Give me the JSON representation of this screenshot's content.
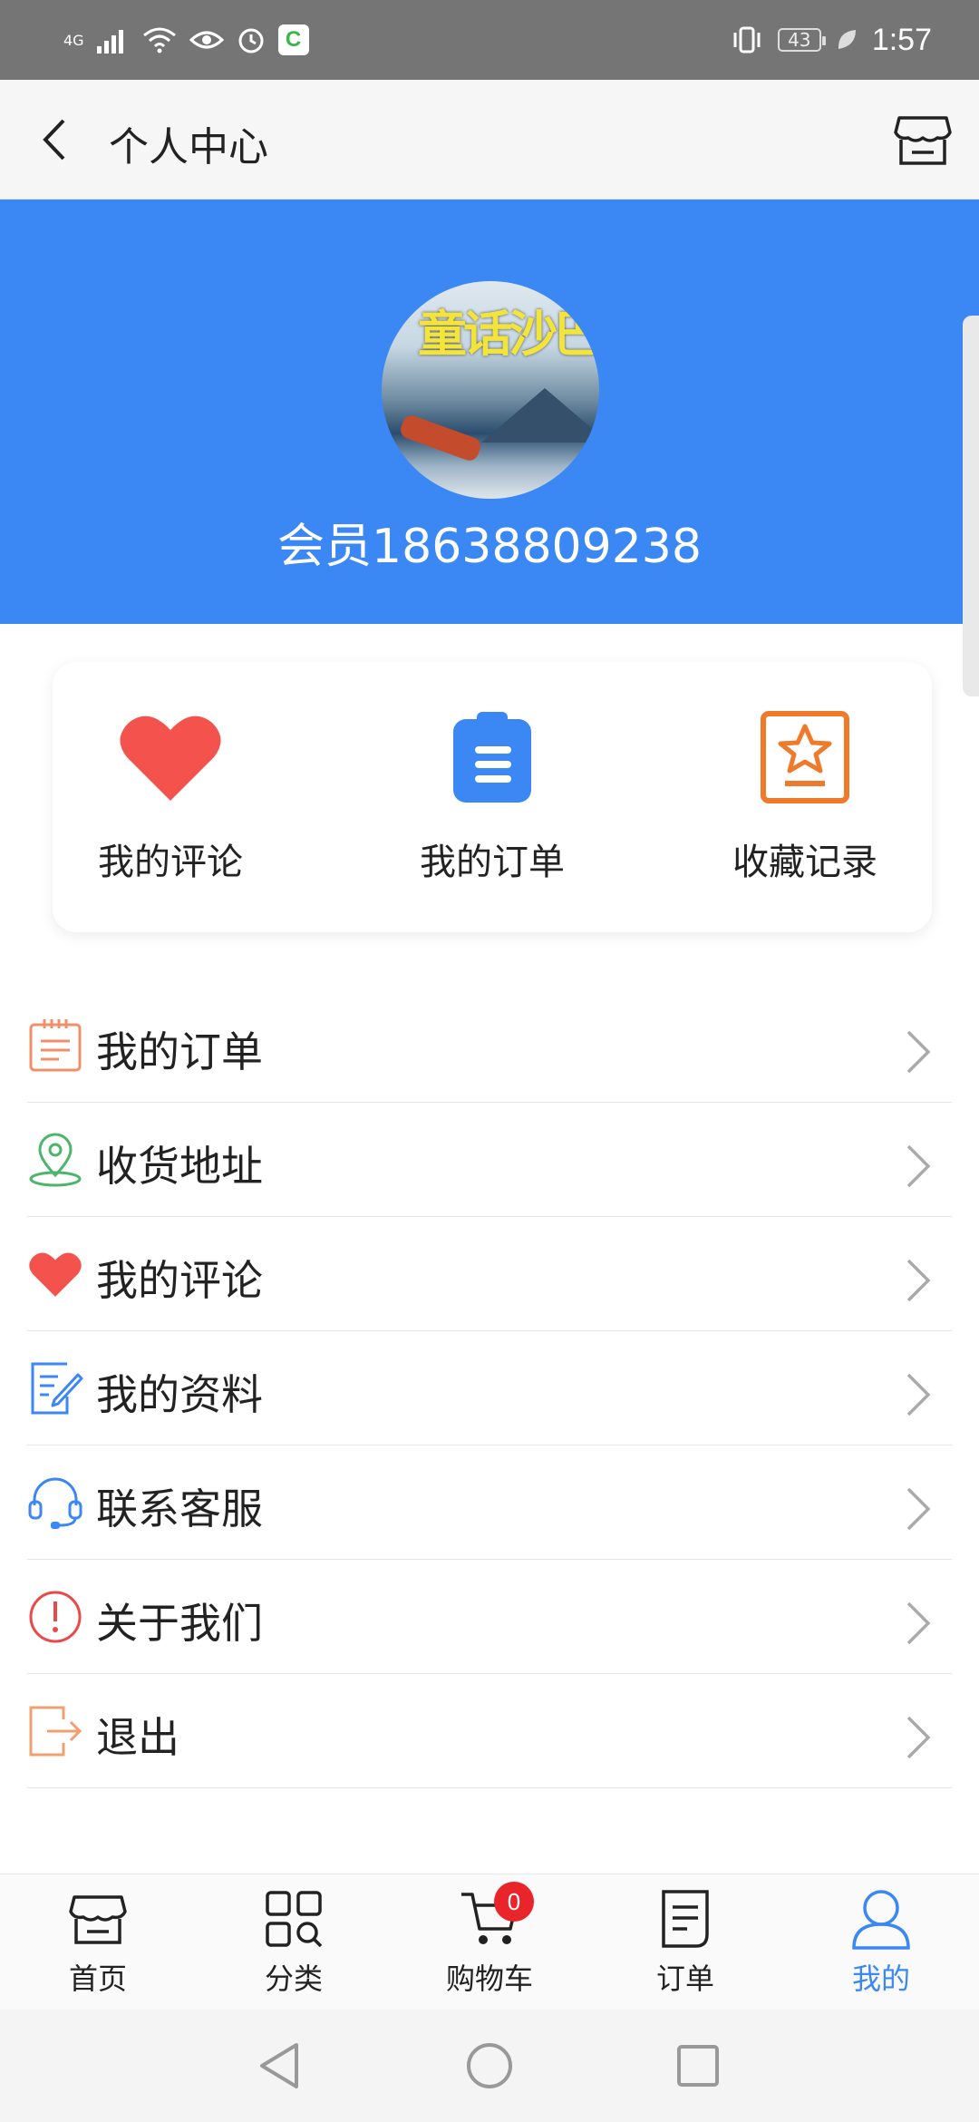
{
  "status_bar": {
    "network": "4G",
    "battery": "43",
    "time": "1:57"
  },
  "header": {
    "title": "个人中心"
  },
  "profile": {
    "member_name": "会员18638809238",
    "avatar_text": "童话沙巴"
  },
  "quick_actions": [
    {
      "label": "我的评论",
      "icon": "heart-icon",
      "color": "#f4524d"
    },
    {
      "label": "我的订单",
      "icon": "clipboard-icon",
      "color": "#3b87f3"
    },
    {
      "label": "收藏记录",
      "icon": "star-book-icon",
      "color": "#f07a2b"
    }
  ],
  "menu": [
    {
      "label": "我的订单",
      "icon": "order-list-icon"
    },
    {
      "label": "收货地址",
      "icon": "location-pin-icon"
    },
    {
      "label": "我的评论",
      "icon": "heart-icon"
    },
    {
      "label": "我的资料",
      "icon": "edit-profile-icon"
    },
    {
      "label": "联系客服",
      "icon": "headset-icon"
    },
    {
      "label": "关于我们",
      "icon": "info-alert-icon"
    },
    {
      "label": "退出",
      "icon": "logout-icon"
    }
  ],
  "tabs": [
    {
      "label": "首页",
      "icon": "store-icon"
    },
    {
      "label": "分类",
      "icon": "category-icon"
    },
    {
      "label": "购物车",
      "icon": "cart-icon",
      "badge": "0"
    },
    {
      "label": "订单",
      "icon": "order-icon"
    },
    {
      "label": "我的",
      "icon": "user-icon",
      "active": true
    }
  ],
  "colors": {
    "primary": "#3b87f3",
    "badge": "#e9242a",
    "heart": "#f4524d",
    "orange": "#f07a2b"
  }
}
